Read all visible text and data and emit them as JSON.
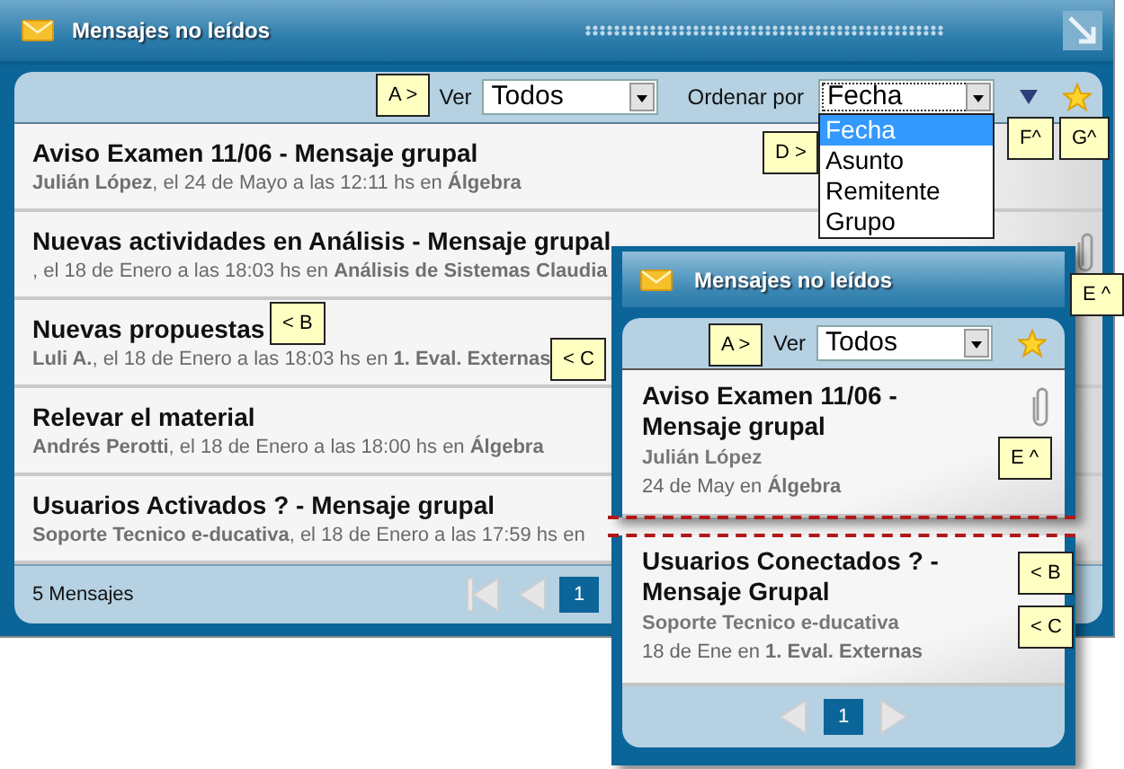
{
  "main_window": {
    "title": "Mensajes no leídos",
    "toolbar": {
      "filter_label": "Ver",
      "filter_value": "Todos",
      "sort_label": "Ordenar por",
      "sort_value": "Fecha"
    },
    "sort_menu": [
      {
        "label": "Fecha",
        "selected": true
      },
      {
        "label": "Asunto",
        "selected": false
      },
      {
        "label": "Remitente",
        "selected": false
      },
      {
        "label": "Grupo",
        "selected": false
      }
    ],
    "messages": [
      {
        "subject": "Aviso Examen 11/06 - Mensaje grupal",
        "meta": "**Julián López**, el 24 de Mayo a las 12:11 hs en **Álgebra**",
        "attachment": false
      },
      {
        "subject": "Nuevas actividades en Análisis - Mensaje grupal",
        "meta": ", el 18 de Enero a las 18:03 hs en **Análisis de Sistemas Claudia**",
        "attachment": true
      },
      {
        "subject": "Nuevas propuestas",
        "meta": "**Luli A.**, el 18 de Enero a las 18:03 hs en **1. Eval. Externas**",
        "attachment": false
      },
      {
        "subject": "Relevar el material",
        "meta": "**Andrés Perotti**, el 18 de Enero a las 18:00 hs en **Álgebra**",
        "attachment": false
      },
      {
        "subject": "Usuarios Activados ? - Mensaje grupal",
        "meta": "**Soporte Tecnico e-ducativa**, el 18 de Enero a las 17:59 hs en",
        "attachment": false
      }
    ],
    "footer": {
      "count": "5 Mensajes",
      "page": "1"
    }
  },
  "mobile_window": {
    "title": "Mensajes no leídos",
    "toolbar": {
      "filter_label": "Ver",
      "filter_value": "Todos"
    },
    "messages": [
      {
        "subject": "Aviso Examen 11/06 - Mensaje grupal",
        "sender": "Julián López",
        "meta": "24 de May en **Álgebra**",
        "attachment": true
      },
      {
        "subject": "Usuarios Conectados ? - Mensaje Grupal",
        "sender": "Soporte Tecnico e-ducativa",
        "meta": "18 de Ene en **1. Eval. Externas**",
        "attachment": false
      }
    ],
    "footer": {
      "page": "1"
    }
  },
  "callouts": [
    {
      "label": "A >"
    },
    {
      "label": "F^"
    },
    {
      "label": "G^"
    },
    {
      "label": "D >"
    },
    {
      "label": "E ^"
    },
    {
      "label": "< B"
    },
    {
      "label": "< C"
    },
    {
      "label": "A >"
    },
    {
      "label": "E ^"
    },
    {
      "label": "< B"
    },
    {
      "label": "< C"
    }
  ]
}
